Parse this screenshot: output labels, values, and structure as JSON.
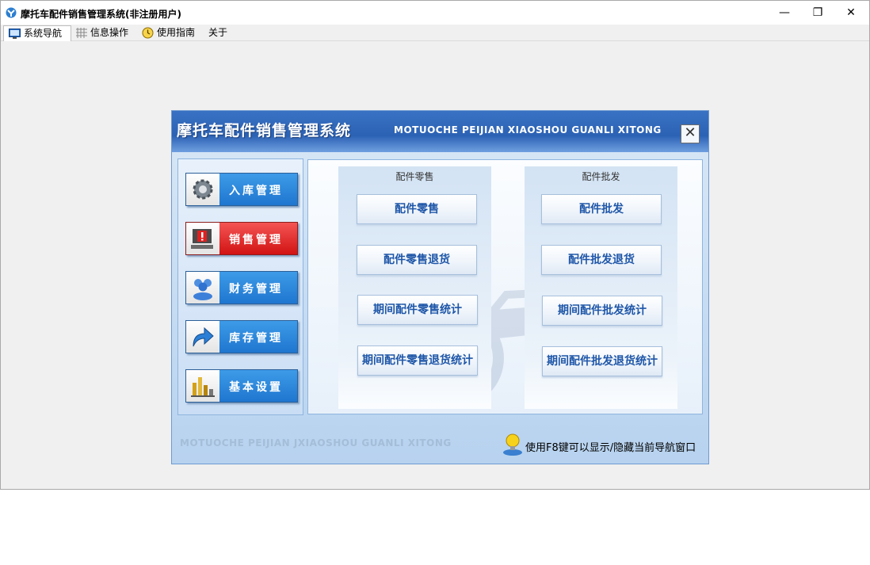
{
  "window": {
    "title": "摩托车配件销售管理系统(非注册用户)",
    "controls": {
      "minimize": "—",
      "maximize": "❐",
      "close": "✕"
    }
  },
  "menu": {
    "tabs": [
      {
        "label": "系统导航",
        "icon": "monitor-icon",
        "active": true
      },
      {
        "label": "信息操作",
        "icon": "grid-icon",
        "active": false
      },
      {
        "label": "使用指南",
        "icon": "clock-icon",
        "active": false
      },
      {
        "label": "关于",
        "active": false
      }
    ]
  },
  "dialog": {
    "title": "摩托车配件销售管理系统",
    "subtitle": "MOTUOCHE PEIJIAN XIAOSHOU GUANLI XITONG",
    "close_symbol": "✕",
    "footer_text": "MOTUOCHE PEIJIAN JXIAOSHOU GUANLI XITONG",
    "hint": "使用F8键可以显示/隐藏当前导航窗口"
  },
  "nav": {
    "items": [
      {
        "label": "入库管理",
        "icon": "gear-icon",
        "active": false
      },
      {
        "label": "销售管理",
        "icon": "alert-computer-icon",
        "active": true
      },
      {
        "label": "财务管理",
        "icon": "users-icon",
        "active": false
      },
      {
        "label": "库存管理",
        "icon": "arrow-icon",
        "active": false
      },
      {
        "label": "基本设置",
        "icon": "chart-tools-icon",
        "active": false
      }
    ]
  },
  "content": {
    "retail": {
      "title": "配件零售",
      "buttons": [
        "配件零售",
        "配件零售退货",
        "期间配件零售统计",
        "期间配件零售退货统计"
      ]
    },
    "wholesale": {
      "title": "配件批发",
      "buttons": [
        "配件批发",
        "配件批发退货",
        "期间配件批发统计",
        "期间配件批发退货统计"
      ]
    }
  },
  "colors": {
    "accent_blue": "#1f76cf",
    "active_red": "#d21313",
    "button_text": "#1e56a8"
  }
}
